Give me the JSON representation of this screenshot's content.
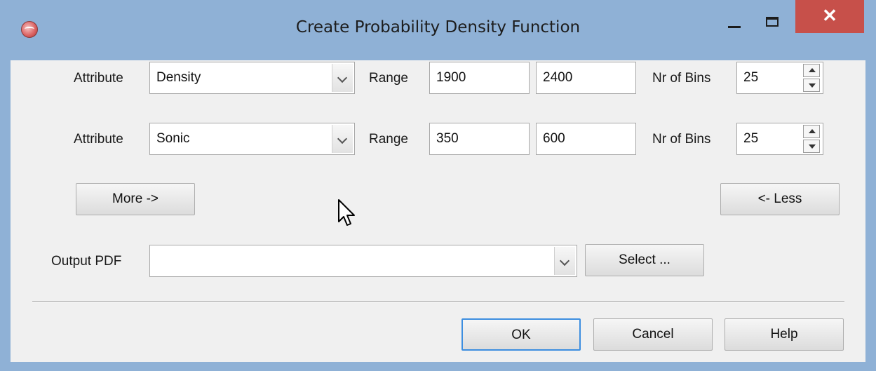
{
  "window": {
    "title": "Create Probability Density Function",
    "icon": "app-logo-icon"
  },
  "rows": [
    {
      "attribute_label": "Attribute",
      "attribute_value": "Density",
      "range_label": "Range",
      "range_min": "1900",
      "range_max": "2400",
      "bins_label": "Nr of Bins",
      "bins_value": "25"
    },
    {
      "attribute_label": "Attribute",
      "attribute_value": "Sonic",
      "range_label": "Range",
      "range_min": "350",
      "range_max": "600",
      "bins_label": "Nr of Bins",
      "bins_value": "25"
    }
  ],
  "more_button": "More ->",
  "less_button": "<- Less",
  "output": {
    "label": "Output PDF",
    "value": "",
    "select_button": "Select ..."
  },
  "footer": {
    "ok": "OK",
    "cancel": "Cancel",
    "help": "Help"
  },
  "colors": {
    "frame": "#8fb1d6",
    "close": "#c7504a",
    "client": "#f0f0f0",
    "default_border": "#3c8ee0"
  }
}
